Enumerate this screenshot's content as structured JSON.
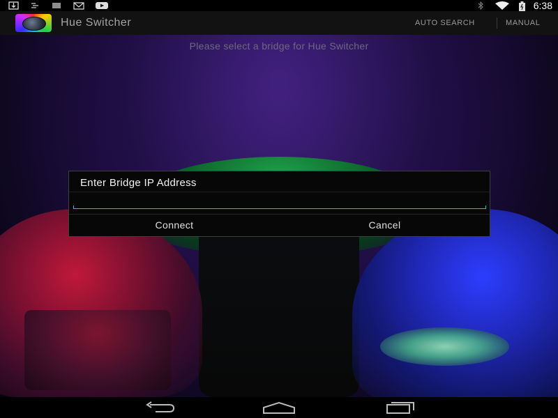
{
  "status_bar": {
    "time": "6:38",
    "left_icons": [
      "download-icon",
      "cast-icon",
      "barcode-icon",
      "gmail-icon",
      "youtube-icon"
    ],
    "right_icons": [
      "bluetooth-icon",
      "wifi-icon",
      "battery-icon"
    ]
  },
  "action_bar": {
    "title": "Hue Switcher",
    "actions": {
      "auto_search": "AUTO SEARCH",
      "manual": "MANUAL"
    }
  },
  "main": {
    "prompt": "Please select a bridge for Hue Switcher"
  },
  "dialog": {
    "title": "Enter Bridge IP Address",
    "ip_input": {
      "value": "",
      "placeholder": ""
    },
    "buttons": {
      "connect": "Connect",
      "cancel": "Cancel"
    }
  },
  "nav_bar": {
    "buttons": [
      "back",
      "home",
      "recent-apps"
    ]
  },
  "colors": {
    "accent": "#33b5e5",
    "action_bar_bg": "#121212",
    "dialog_bg": "#070707",
    "title_text": "#a5a5a5"
  }
}
